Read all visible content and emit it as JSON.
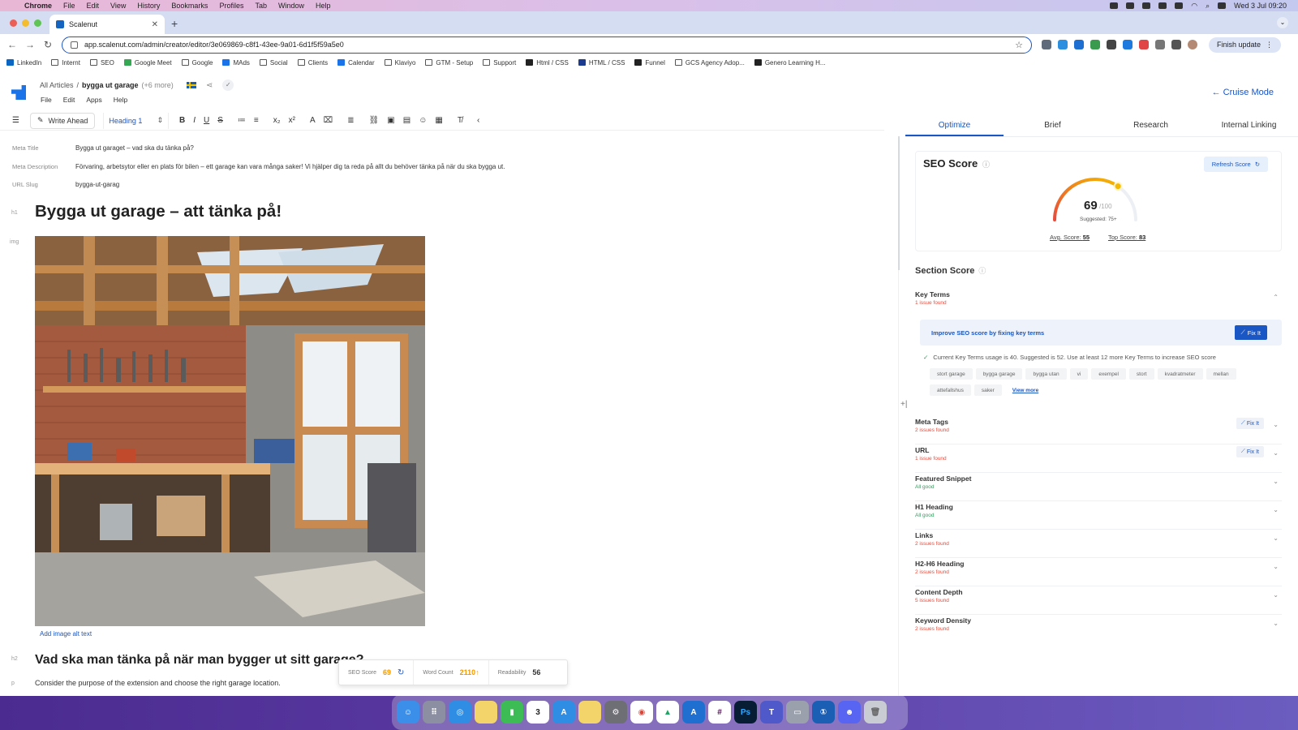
{
  "mac_menubar": {
    "app": "Chrome",
    "items": [
      "File",
      "Edit",
      "View",
      "History",
      "Bookmarks",
      "Profiles",
      "Tab",
      "Window",
      "Help"
    ],
    "clock": "Wed 3 Jul 09:20"
  },
  "browser": {
    "tab_title": "Scalenut",
    "url": "app.scalenut.com/admin/creator/editor/3e069869-c8f1-43ee-9a01-6d1f5f59a5e0",
    "finish_update": "Finish update"
  },
  "bookmarks": [
    "LinkedIn",
    "Internt",
    "SEO",
    "Google Meet",
    "Google",
    "MAds",
    "Social",
    "Clients",
    "Calendar",
    "Klaviyo",
    "GTM - Setup",
    "Support",
    "Html / CSS",
    "HTML / CSS",
    "Funnel",
    "GCS Agency Adop...",
    "Genero Learning H..."
  ],
  "app": {
    "breadcrumb_root": "All Articles",
    "breadcrumb_sep": "/",
    "article_name": "bygga ut garage",
    "more": "(+6 more)",
    "menu": [
      "File",
      "Edit",
      "Apps",
      "Help"
    ],
    "cruise_mode": "← Cruise Mode"
  },
  "toolbar": {
    "write_ahead": "Write Ahead",
    "heading": "Heading 1"
  },
  "meta": {
    "title_label": "Meta Title",
    "title_value": "Bygga ut garaget – vad ska du tänka på?",
    "desc_label": "Meta Description",
    "desc_value": "Förvaring, arbetsytor eller en plats för bilen – ett garage kan vara många saker! Vi hjälper dig ta reda på allt du behöver tänka på när du ska bygga ut.",
    "slug_label": "URL Slug",
    "slug_value": "bygga-ut-garag"
  },
  "document": {
    "h1_tag": "h1",
    "h1": "Bygga ut garage – att tänka på!",
    "img_tag": "img",
    "add_alt": "Add image alt text",
    "h2_tag": "h2",
    "h2": "Vad ska man tänka på när man bygger ut sitt garage?",
    "p_tag": "p",
    "p": "Consider the purpose of the extension and choose the right garage location."
  },
  "floating_stats": {
    "seo_label": "SEO Score",
    "seo_value": "69",
    "wc_label": "Word Count",
    "wc_value": "2110↑",
    "read_label": "Readability",
    "read_value": "56"
  },
  "right_panel": {
    "tabs": [
      "Optimize",
      "Brief",
      "Research",
      "Internal Linking"
    ],
    "seo_title": "SEO Score",
    "refresh": "Refresh Score",
    "score": "69",
    "score_den": "/100",
    "suggested": "Suggested: 75+",
    "avg_label": "Avg. Score:",
    "avg_value": "55",
    "top_label": "Top Score:",
    "top_value": "83",
    "score_fraction": 0.69,
    "section_score": "Section Score",
    "key_terms": {
      "name": "Key Terms",
      "status": "1 issue found",
      "improve": "Improve SEO score by fixing key terms",
      "fix": "Fix It",
      "note": "Current Key Terms usage is 40. Suggested is 52. Use at least 12 more Key Terms to increase SEO score",
      "chips": [
        "stort garage",
        "bygga garage",
        "bygga utan",
        "vi",
        "exempel",
        "stort",
        "kvadratmeter",
        "mellan",
        "attefallshus",
        "saker"
      ],
      "view_more": "View more"
    },
    "categories": [
      {
        "name": "Meta Tags",
        "status": "2 issues found",
        "state": "bad",
        "fix": "Fix It"
      },
      {
        "name": "URL",
        "status": "1 issue found",
        "state": "bad",
        "fix": "Fix It"
      },
      {
        "name": "Featured Snippet",
        "status": "All good",
        "state": "good",
        "fix": ""
      },
      {
        "name": "H1 Heading",
        "status": "All good",
        "state": "good",
        "fix": ""
      },
      {
        "name": "Links",
        "status": "2 issues found",
        "state": "bad",
        "fix": ""
      },
      {
        "name": "H2-H6 Heading",
        "status": "2 issues found",
        "state": "bad",
        "fix": ""
      },
      {
        "name": "Content Depth",
        "status": "5 issues found",
        "state": "bad",
        "fix": ""
      },
      {
        "name": "Keyword Density",
        "status": "2 issues found",
        "state": "bad",
        "fix": ""
      }
    ]
  },
  "colors": {
    "accent": "#1a56c4",
    "gauge_start": "#e84b3c",
    "gauge_end": "#f5b800",
    "bad": "#e84b3c",
    "good": "#2f9e5a",
    "score_orange": "#f29900"
  },
  "dock": {
    "calendar_day": "3",
    "apps": [
      "finder",
      "launchpad",
      "safari",
      "notes",
      "numbers",
      "calendar",
      "app-store",
      "stickies",
      "system-settings",
      "chrome",
      "google-drive",
      "azure-data-studio",
      "slack",
      "photoshop",
      "teams",
      "screen-sharing",
      "1password",
      "discord",
      "trash"
    ]
  }
}
